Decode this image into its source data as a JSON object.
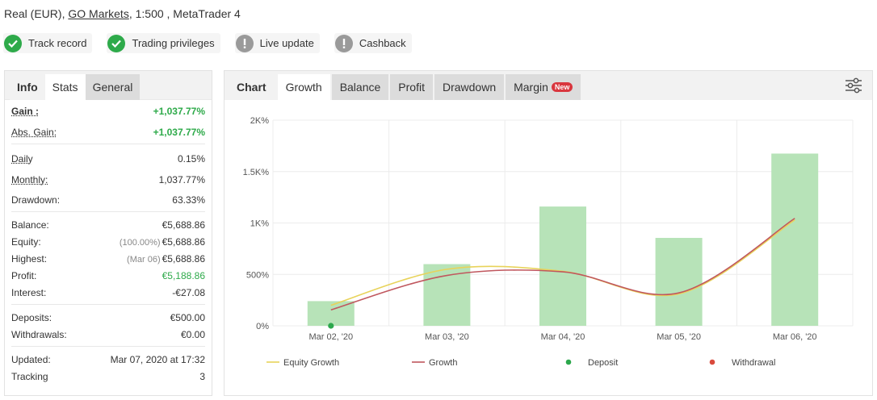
{
  "account": {
    "type": "Real (EUR),",
    "broker": "GO Markets",
    "rest": ", 1:500 , MetaTrader 4"
  },
  "badges": [
    {
      "label": "Track record",
      "status": "ok"
    },
    {
      "label": "Trading privileges",
      "status": "ok"
    },
    {
      "label": "Live update",
      "status": "warn"
    },
    {
      "label": "Cashback",
      "status": "warn"
    }
  ],
  "left_tabs": [
    "Info",
    "Stats",
    "General"
  ],
  "stats": {
    "gain": {
      "label": "Gain :",
      "value": "+1,037.77%"
    },
    "abs_gain": {
      "label": "Abs. Gain:",
      "value": "+1,037.77%"
    },
    "daily": {
      "label": "Daily",
      "value": "0.15%"
    },
    "monthly": {
      "label": "Monthly:",
      "value": "1,037.77%"
    },
    "drawdown": {
      "label": "Drawdown:",
      "value": "63.33%"
    },
    "balance": {
      "label": "Balance:",
      "value": "€5,688.86"
    },
    "equity": {
      "label": "Equity:",
      "prefix": "(100.00%)",
      "value": "€5,688.86"
    },
    "highest": {
      "label": "Highest:",
      "prefix": "(Mar 06)",
      "value": "€5,688.86"
    },
    "profit": {
      "label": "Profit:",
      "value": "€5,188.86"
    },
    "interest": {
      "label": "Interest:",
      "value": "-€27.08"
    },
    "deposits": {
      "label": "Deposits:",
      "value": "€500.00"
    },
    "withdrawals": {
      "label": "Withdrawals:",
      "value": "€0.00"
    },
    "updated": {
      "label": "Updated:",
      "value": "Mar 07, 2020 at 17:32"
    },
    "tracking": {
      "label": "Tracking",
      "value": "3"
    }
  },
  "chart_tabs": {
    "chart": "Chart",
    "growth": "Growth",
    "balance": "Balance",
    "profit": "Profit",
    "drawdown": "Drawdown",
    "margin": "Margin",
    "new_badge": "New"
  },
  "chart_data": {
    "type": "bar",
    "categories": [
      "Mar 02, '20",
      "Mar 03, '20",
      "Mar 04, '20",
      "Mar 05, '20",
      "Mar 06, '20"
    ],
    "yticks": [
      "0%",
      "500%",
      "1K%",
      "1.5K%",
      "2K%"
    ],
    "ylim": [
      0,
      2000
    ],
    "bars": [
      240,
      600,
      1160,
      855,
      1675
    ],
    "series": [
      {
        "name": "Equity Growth",
        "color": "#e8d35a",
        "values": [
          200,
          550,
          530,
          310,
          1030
        ]
      },
      {
        "name": "Growth",
        "color": "#c0575e",
        "values": [
          155,
          490,
          525,
          320,
          1045
        ]
      }
    ],
    "deposit_points": [
      {
        "x_index": 0,
        "value": 0
      }
    ],
    "legend": [
      {
        "name": "Equity Growth",
        "kind": "line",
        "color": "#e8d35a"
      },
      {
        "name": "Growth",
        "kind": "line",
        "color": "#c0575e"
      },
      {
        "name": "Deposit",
        "kind": "dot",
        "color": "#2ca84c"
      },
      {
        "name": "Withdrawal",
        "kind": "dot",
        "color": "#d94a3d"
      }
    ],
    "bar_color": "#b7e3b8",
    "grid": true,
    "legend_position": "bottom"
  }
}
